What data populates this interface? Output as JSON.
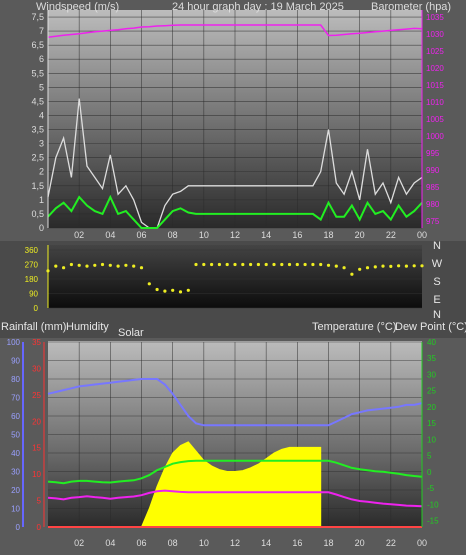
{
  "header": {
    "left_label": "Windspeed (m/s)",
    "title": "24 hour graph day : 19 March 2025",
    "right_label": "Barometer (hpa)"
  },
  "colors": {
    "wind_gust": "#dddddd",
    "wind_avg": "#22ee22",
    "barometer": "#ee22ee",
    "direction": "#eeee22",
    "rain_axis": "#6666ff",
    "humidity_axis": "#ff3333",
    "temp_axis": "#22cc22",
    "humidity": "#7777ff",
    "solar": "#ffff00",
    "temperature": "#22ee22",
    "dew_point": "#ee22ee",
    "rainfall": "#ff4444"
  },
  "mid_labels": {
    "rainfall": "Rainfall (mm)",
    "humidity": "Humidity",
    "solar": "Solar",
    "temperature": "Temperature (°C)",
    "dew_point": "Dew Point (°C)"
  },
  "chart_data": [
    {
      "type": "line",
      "title": "24 hour graph day : 19 March 2025",
      "x": [
        0,
        0.5,
        1,
        1.5,
        2,
        2.5,
        3,
        3.5,
        4,
        4.5,
        5,
        5.5,
        6,
        6.5,
        7,
        7.5,
        8,
        8.5,
        9,
        9.5,
        10,
        10.5,
        11,
        11.5,
        12,
        12.5,
        13,
        13.5,
        14,
        14.5,
        15,
        15.5,
        16,
        16.5,
        17,
        17.5,
        18,
        18.5,
        19,
        19.5,
        20,
        20.5,
        21,
        21.5,
        22,
        22.5,
        23,
        23.5,
        24
      ],
      "xticks": [
        "02",
        "04",
        "06",
        "08",
        "10",
        "12",
        "14",
        "16",
        "18",
        "20",
        "22",
        "00"
      ],
      "xtick_hours": [
        2,
        4,
        6,
        8,
        10,
        12,
        14,
        16,
        18,
        20,
        22,
        24
      ],
      "y_left_label": "Windspeed (m/s)",
      "y_left_ticks": [
        "0",
        "0,5",
        "1",
        "1,5",
        "2",
        "2,5",
        "3",
        "3,5",
        "4",
        "4,5",
        "5",
        "5,5",
        "6",
        "6,5",
        "7",
        "7,5"
      ],
      "ylim_left": [
        0,
        7.75
      ],
      "y_right_label": "Barometer (hpa)",
      "y_right_ticks": [
        "975",
        "980",
        "985",
        "990",
        "995",
        "1000",
        "1005",
        "1010",
        "1015",
        "1020",
        "1025",
        "1030",
        "1035"
      ],
      "ylim_right": [
        973,
        1037
      ],
      "series": [
        {
          "name": "Windspeed (m/s)",
          "axis": "left",
          "values": [
            1.1,
            2.5,
            3.2,
            1.8,
            4.6,
            2.2,
            1.8,
            1.4,
            2.6,
            1.2,
            1.5,
            1.0,
            0.2,
            0,
            0,
            0.8,
            1.2,
            1.3,
            1.5,
            1.5,
            1.5,
            1.5,
            1.5,
            1.5,
            1.5,
            1.5,
            1.5,
            1.5,
            1.5,
            1.5,
            1.5,
            1.5,
            1.5,
            1.5,
            1.5,
            2.0,
            3.5,
            1.6,
            1.2,
            2.0,
            1.0,
            2.8,
            1.2,
            1.6,
            0.9,
            1.8,
            1.2,
            1.6,
            1.8
          ]
        },
        {
          "name": "Wind average",
          "axis": "left",
          "values": [
            0.4,
            0.7,
            0.9,
            0.6,
            1.1,
            0.8,
            0.6,
            0.5,
            1.1,
            0.5,
            0.6,
            0.3,
            0,
            0,
            0,
            0.3,
            0.6,
            0.7,
            0.55,
            0.5,
            0.5,
            0.5,
            0.5,
            0.5,
            0.5,
            0.5,
            0.5,
            0.5,
            0.5,
            0.5,
            0.5,
            0.5,
            0.5,
            0.5,
            0.5,
            0.3,
            0.9,
            0.4,
            0.4,
            0.8,
            0.3,
            0.9,
            0.5,
            0.6,
            0.3,
            0.8,
            0.4,
            0.6,
            0.9
          ]
        },
        {
          "name": "Barometer (hpa)",
          "axis": "right",
          "values": [
            1029,
            1029.3,
            1029.6,
            1029.8,
            1030,
            1030.3,
            1030.6,
            1030.8,
            1031,
            1031.2,
            1031.5,
            1031.7,
            1032,
            1032.1,
            1032.3,
            1032.4,
            1032.5,
            1032.6,
            1032.6,
            1032.6,
            1032.6,
            1032.6,
            1032.6,
            1032.6,
            1032.6,
            1032.6,
            1032.6,
            1032.6,
            1032.6,
            1032.6,
            1032.6,
            1032.6,
            1032.6,
            1032.6,
            1032.6,
            1032.6,
            1029.5,
            1029.6,
            1029.8,
            1030,
            1030.2,
            1030.4,
            1030.6,
            1030.8,
            1031,
            1031.2,
            1031.4,
            1031.6,
            1031.5
          ]
        }
      ]
    },
    {
      "type": "scatter",
      "x": [
        0,
        0.5,
        1,
        1.5,
        2,
        2.5,
        3,
        3.5,
        4,
        4.5,
        5,
        5.5,
        6,
        6.5,
        7,
        7.5,
        8,
        8.5,
        9,
        9.5,
        10,
        10.5,
        11,
        11.5,
        12,
        12.5,
        13,
        13.5,
        14,
        14.5,
        15,
        15.5,
        16,
        16.5,
        17,
        17.5,
        18,
        18.5,
        19,
        19.5,
        20,
        20.5,
        21,
        21.5,
        22,
        22.5,
        23,
        23.5,
        24
      ],
      "y_ticks": [
        "0",
        "90",
        "180",
        "270",
        "360"
      ],
      "ylim": [
        0,
        360
      ],
      "y_right_labels": [
        "N",
        "W",
        "S",
        "E",
        "N"
      ],
      "series": [
        {
          "name": "Wind direction",
          "values": [
            230,
            260,
            250,
            270,
            265,
            260,
            265,
            270,
            265,
            260,
            265,
            260,
            250,
            150,
            115,
            105,
            110,
            100,
            110,
            270,
            270,
            270,
            270,
            270,
            270,
            270,
            270,
            270,
            270,
            270,
            270,
            270,
            270,
            270,
            270,
            270,
            265,
            260,
            250,
            210,
            240,
            250,
            255,
            260,
            258,
            262,
            260,
            262,
            262
          ]
        }
      ]
    },
    {
      "type": "line",
      "x": [
        0,
        0.5,
        1,
        1.5,
        2,
        2.5,
        3,
        3.5,
        4,
        4.5,
        5,
        5.5,
        6,
        6.5,
        7,
        7.5,
        8,
        8.5,
        9,
        9.5,
        10,
        10.5,
        11,
        11.5,
        12,
        12.5,
        13,
        13.5,
        14,
        14.5,
        15,
        15.5,
        16,
        16.5,
        17,
        17.5,
        18,
        18.5,
        19,
        19.5,
        20,
        20.5,
        21,
        21.5,
        22,
        22.5,
        23,
        23.5,
        24
      ],
      "xticks": [
        "02",
        "04",
        "06",
        "08",
        "10",
        "12",
        "14",
        "16",
        "18",
        "20",
        "22",
        "00"
      ],
      "xtick_hours": [
        2,
        4,
        6,
        8,
        10,
        12,
        14,
        16,
        18,
        20,
        22,
        24
      ],
      "y_humidity_ticks": [
        "0",
        "10",
        "20",
        "30",
        "40",
        "50",
        "60",
        "70",
        "80",
        "90",
        "100"
      ],
      "ylim_humidity": [
        0,
        100
      ],
      "y_rain_ticks": [
        "0",
        "5",
        "10",
        "15",
        "20",
        "25",
        "30",
        "35"
      ],
      "ylim_rain": [
        0,
        35
      ],
      "y_temp_ticks": [
        "-15",
        "-10",
        "-5",
        "0",
        "5",
        "10",
        "15",
        "20",
        "25",
        "30",
        "35",
        "40"
      ],
      "ylim_temp": [
        -17,
        40
      ],
      "series": [
        {
          "name": "Humidity",
          "axis": "humidity",
          "values": [
            72,
            73,
            74,
            75,
            76,
            76.5,
            77,
            77.5,
            78,
            78.5,
            79,
            79.5,
            80,
            80,
            80,
            77,
            72,
            66,
            60,
            56,
            55,
            55,
            55,
            55,
            55,
            55,
            55,
            55,
            55,
            55,
            55,
            55,
            55,
            55,
            55,
            55,
            55,
            57,
            59,
            61,
            62,
            63,
            63.5,
            64,
            64.5,
            65,
            66,
            66,
            67
          ]
        },
        {
          "name": "Solar",
          "axis": "humidity",
          "values": [
            0,
            0,
            0,
            0,
            0,
            0,
            0,
            0,
            0,
            0,
            0,
            0,
            0,
            10,
            22,
            32,
            40,
            44,
            46,
            41,
            36,
            33,
            31,
            30,
            30,
            30.5,
            32,
            34,
            37,
            40,
            42,
            43,
            43,
            43,
            43,
            43,
            0,
            0,
            0,
            0,
            0,
            0,
            0,
            0,
            0,
            0,
            0,
            0,
            0
          ]
        },
        {
          "name": "Temperature (°C)",
          "axis": "temp",
          "values": [
            -3,
            -3.2,
            -3.5,
            -3,
            -2.8,
            -2.8,
            -3,
            -3.2,
            -3.3,
            -3,
            -2.8,
            -2.6,
            -2,
            -1,
            0.5,
            1.5,
            2.5,
            3,
            3.3,
            3.4,
            3.4,
            3.4,
            3.4,
            3.4,
            3.4,
            3.4,
            3.4,
            3.4,
            3.4,
            3.4,
            3.4,
            3.4,
            3.4,
            3.4,
            3.4,
            3.4,
            3.4,
            2.8,
            2,
            1.2,
            0.8,
            0.5,
            0.2,
            0,
            -0.3,
            -0.6,
            -1,
            -1.3,
            -1.5
          ]
        },
        {
          "name": "Dew Point (°C)",
          "axis": "temp",
          "values": [
            -8,
            -8.2,
            -8.5,
            -8,
            -7.8,
            -7.5,
            -7.8,
            -8,
            -8.3,
            -8,
            -7.8,
            -7.6,
            -7.2,
            -6.5,
            -6,
            -5.8,
            -6,
            -6.2,
            -6.3,
            -6.3,
            -6.3,
            -6.3,
            -6.3,
            -6.3,
            -6.3,
            -6.3,
            -6.3,
            -6.3,
            -6.3,
            -6.3,
            -6.3,
            -6.3,
            -6.3,
            -6.3,
            -6.3,
            -6.3,
            -6.3,
            -7,
            -7.8,
            -8.5,
            -9,
            -9.2,
            -9.5,
            -9.8,
            -10,
            -10.2,
            -10.4,
            -10.5,
            -10.6
          ]
        },
        {
          "name": "Rainfall (mm)",
          "axis": "rain",
          "values": [
            0,
            0,
            0,
            0,
            0,
            0,
            0,
            0,
            0,
            0,
            0,
            0,
            0,
            0,
            0,
            0,
            0,
            0,
            0,
            0,
            0,
            0,
            0,
            0,
            0,
            0,
            0,
            0,
            0,
            0,
            0,
            0,
            0,
            0,
            0,
            0,
            0,
            0,
            0,
            0,
            0,
            0,
            0,
            0,
            0,
            0,
            0,
            0,
            0
          ]
        }
      ]
    }
  ]
}
